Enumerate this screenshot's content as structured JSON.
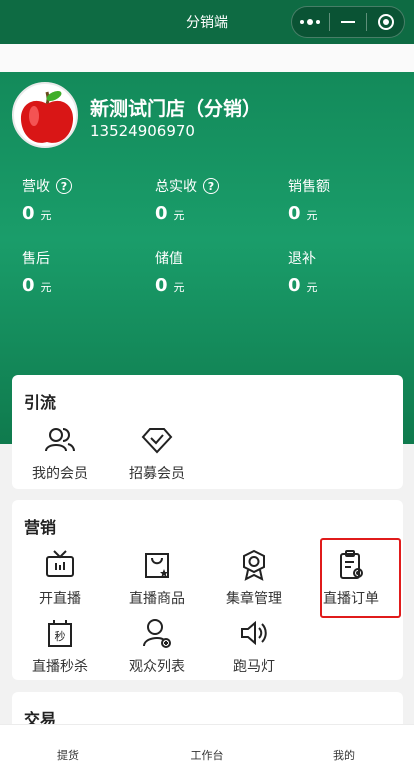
{
  "window": {
    "title": "分销端"
  },
  "store": {
    "name": "新测试门店（分销）",
    "phone": "13524906970"
  },
  "stats": [
    {
      "label": "营收",
      "value": "0",
      "unit": "元",
      "has_help": true
    },
    {
      "label": "总实收",
      "value": "0",
      "unit": "元",
      "has_help": true
    },
    {
      "label": "销售额",
      "value": "0",
      "unit": "元",
      "has_help": false
    },
    {
      "label": "售后",
      "value": "0",
      "unit": "元",
      "has_help": false
    },
    {
      "label": "储值",
      "value": "0",
      "unit": "元",
      "has_help": false
    },
    {
      "label": "退补",
      "value": "0",
      "unit": "元",
      "has_help": false
    }
  ],
  "sections": {
    "traffic": {
      "title": "引流",
      "items": [
        {
          "label": "我的会员",
          "icon": "members-icon"
        },
        {
          "label": "招募会员",
          "icon": "recruit-member-icon"
        }
      ]
    },
    "marketing": {
      "title": "营销",
      "items": [
        {
          "label": "开直播",
          "icon": "tv-icon"
        },
        {
          "label": "直播商品",
          "icon": "shopping-bag-icon"
        },
        {
          "label": "集章管理",
          "icon": "badge-icon"
        },
        {
          "label": "直播订单",
          "icon": "order-clipboard-icon"
        },
        {
          "label": "直播秒杀",
          "icon": "flash-sale-icon"
        },
        {
          "label": "观众列表",
          "icon": "audience-icon"
        },
        {
          "label": "跑马灯",
          "icon": "speaker-icon"
        }
      ]
    },
    "trade": {
      "title": "交易"
    }
  },
  "tabbar": {
    "items": [
      {
        "label": "提货"
      },
      {
        "label": "工作台"
      },
      {
        "label": "我的"
      }
    ]
  },
  "colors": {
    "header": "#0e6b43",
    "hero": "#1a9d6a",
    "highlight": "#e01b1b"
  }
}
